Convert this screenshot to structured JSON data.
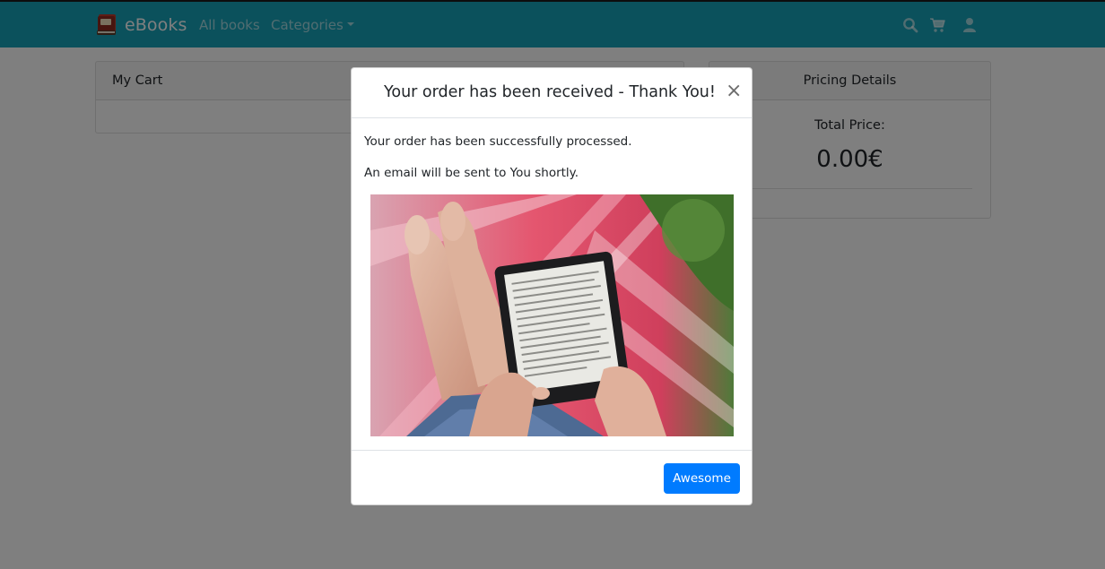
{
  "navbar": {
    "brand": "eBooks",
    "links": {
      "all_books": "All books",
      "categories": "Categories"
    },
    "icons": [
      "search-icon",
      "cart-icon",
      "user-icon"
    ],
    "background": "#17a2b8"
  },
  "cart": {
    "title": "My Cart"
  },
  "pricing": {
    "title": "Pricing Details",
    "total_label": "Total Price:",
    "total_value": "0.00€"
  },
  "modal": {
    "title": "Your order has been received - Thank You!",
    "close_symbol": "×",
    "messages": [
      "Your order has been successfully processed.",
      "An email will be sent to You shortly."
    ],
    "image_alt": "person reading an e-reader in a hammock",
    "confirm_button": "Awesome"
  },
  "colors": {
    "primary": "#007bff",
    "backdrop": "rgba(0,0,0,0.5)"
  }
}
